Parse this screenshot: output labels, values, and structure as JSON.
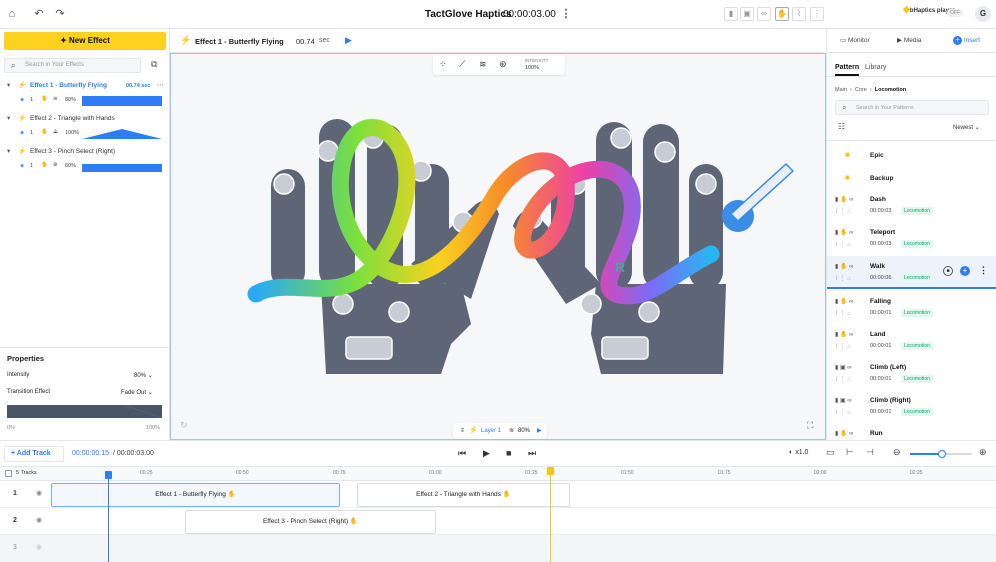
{
  "header": {
    "title": "TactGlove Haptics",
    "time": "00:00:03.00",
    "bhaptics_logo": "bHaptics player",
    "player_status": "OFF",
    "avatar_initial": "G"
  },
  "left": {
    "new_effect_label": "New Effect",
    "search_placeholder": "Search in Your Effects",
    "effects": [
      {
        "name": "Effect 1 - Butterfly Flying",
        "duration": "00.74 sec",
        "count": "1",
        "intensity": "80%"
      },
      {
        "name": "Effect 2 - Triangle with Hands",
        "count": "1",
        "intensity": "100%"
      },
      {
        "name": "Effect 3 - Pinch Select (Right)",
        "count": "1",
        "intensity": "60%"
      }
    ],
    "properties": {
      "title": "Properties",
      "intensity_label": "Intensity",
      "intensity_value": "80%",
      "transition_label": "Transition Effect",
      "transition_value": "Fade Out",
      "graph_min": "0%",
      "graph_max": "100%"
    }
  },
  "editor": {
    "effect_name": "Effect 1 - Butterfly Flying",
    "duration_value": "00.74",
    "duration_unit": "sec",
    "intensity_label": "INTENSITY",
    "intensity_value": "100%",
    "right_hand_label": "R",
    "layer_label": "Layer 1",
    "layer_intensity": "80%"
  },
  "right": {
    "tabs": [
      "Monitor",
      "Media",
      "Insert"
    ],
    "subtabs": [
      "Pattern",
      "Library"
    ],
    "breadcrumb": [
      "Main",
      "Core",
      "Locomotion"
    ],
    "search_placeholder": "Search in Your Patterns",
    "sort_label": "Newest",
    "folders": [
      "Epic",
      "Backup"
    ],
    "patterns": [
      {
        "name": "Dash",
        "duration": "00:00:03",
        "tag": "Locomotion"
      },
      {
        "name": "Teleport",
        "duration": "00:00:03",
        "tag": "Locomotion"
      },
      {
        "name": "Walk",
        "duration": "00:00:06",
        "tag": "Locomotion"
      },
      {
        "name": "Falling",
        "duration": "00:00:01",
        "tag": "Locomotion"
      },
      {
        "name": "Land",
        "duration": "00:00:01",
        "tag": "Locomotion"
      },
      {
        "name": "Climb (Left)",
        "duration": "00:00:01",
        "tag": "Locomotion"
      },
      {
        "name": "Climb (Right)",
        "duration": "00:00:01",
        "tag": "Locomotion"
      },
      {
        "name": "Run",
        "duration": "",
        "tag": ""
      }
    ]
  },
  "timeline": {
    "add_track_label": "Add Track",
    "current_time": "00:00:00.15",
    "total_time": "/ 00:00:03.00",
    "speed": "x1.0",
    "tracks_label": "5 Tracks",
    "ticks": [
      "00:25",
      "00:50",
      "00:75",
      "01:00",
      "01:25",
      "01:50",
      "01:75",
      "02:00",
      "02:25"
    ],
    "tracks": [
      {
        "num": "1",
        "clips": [
          "Effect 1 - Butterfly Flying",
          "Effect 2 - Triangle with Hands"
        ]
      },
      {
        "num": "2",
        "clips": [
          "Effect 3 - Pinch Select (Right)"
        ]
      },
      {
        "num": "3",
        "clips": []
      }
    ]
  }
}
